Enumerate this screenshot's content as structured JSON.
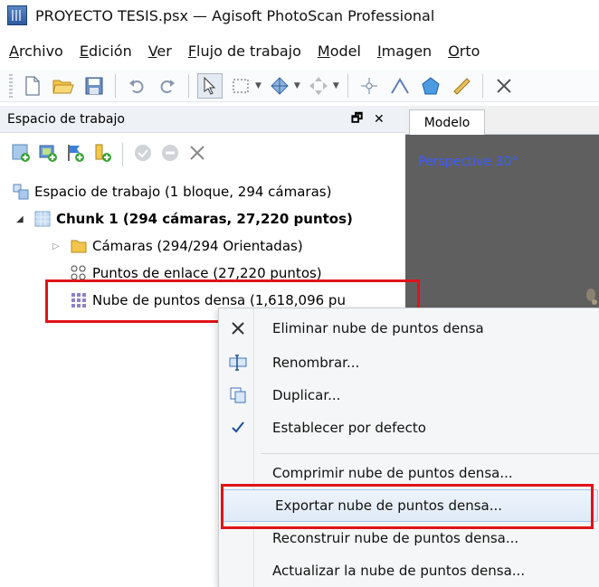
{
  "window": {
    "title": "PROYECTO TESIS.psx — Agisoft PhotoScan Professional"
  },
  "menu": [
    {
      "label": "Archivo",
      "underline": "A",
      "rest": "rchivo"
    },
    {
      "label": "Edición",
      "underline": "E",
      "rest": "dición"
    },
    {
      "label": "Ver",
      "underline": "V",
      "rest": "er"
    },
    {
      "label": "Flujo de trabajo",
      "underline": "F",
      "rest": "lujo de trabajo"
    },
    {
      "label": "Model",
      "underline": "M",
      "rest": "odel"
    },
    {
      "label": "Imagen",
      "underline": "I",
      "rest": "magen"
    },
    {
      "label": "Orto",
      "underline": "O",
      "rest": "rto"
    }
  ],
  "toolbar_icons": [
    "new-icon",
    "open-icon",
    "save-icon",
    "undo-icon",
    "redo-icon",
    "navigation-icon",
    "rectangle-selection-icon",
    "resize-region-icon",
    "rotate-object-icon",
    "ruler-point-icon",
    "ruler-line-icon",
    "shape-polygon-icon",
    "ruler-icon",
    "delete-icon"
  ],
  "workspace": {
    "title": "Espacio de trabajo",
    "float_btn": "🗗",
    "close_btn": "✕",
    "tree": {
      "root": "Espacio de trabajo (1 bloque, 294 cámaras)",
      "chunk": "Chunk 1 (294 cámaras, 27,220 puntos)",
      "cameras": "Cámaras (294/294 Orientadas)",
      "tie_points": "Puntos de enlace (27,220 puntos)",
      "dense_cloud": "Nube de puntos densa (1,618,096 pu"
    }
  },
  "viewport": {
    "tab": "Modelo",
    "perspective": "Perspective 30°"
  },
  "context_menu": {
    "items": [
      {
        "label": "Eliminar nube de puntos densa",
        "icon": "delete-icon"
      },
      {
        "label": "Renombrar...",
        "icon": "rename-icon"
      },
      {
        "label": "Duplicar...",
        "icon": "duplicate-icon"
      },
      {
        "label": "Establecer por defecto",
        "icon": "checkmark-icon"
      },
      {
        "label": "Comprimir nube de puntos densa...",
        "icon": ""
      },
      {
        "label": "Exportar nube de puntos densa...",
        "icon": ""
      },
      {
        "label": "Reconstruir nube de puntos densa...",
        "icon": ""
      },
      {
        "label": "Actualizar la nube de puntos densa...",
        "icon": ""
      }
    ]
  },
  "colors": {
    "highlight": "#e0131a",
    "hover": "#dfeaf7",
    "perspective_text": "#3a5cff"
  }
}
